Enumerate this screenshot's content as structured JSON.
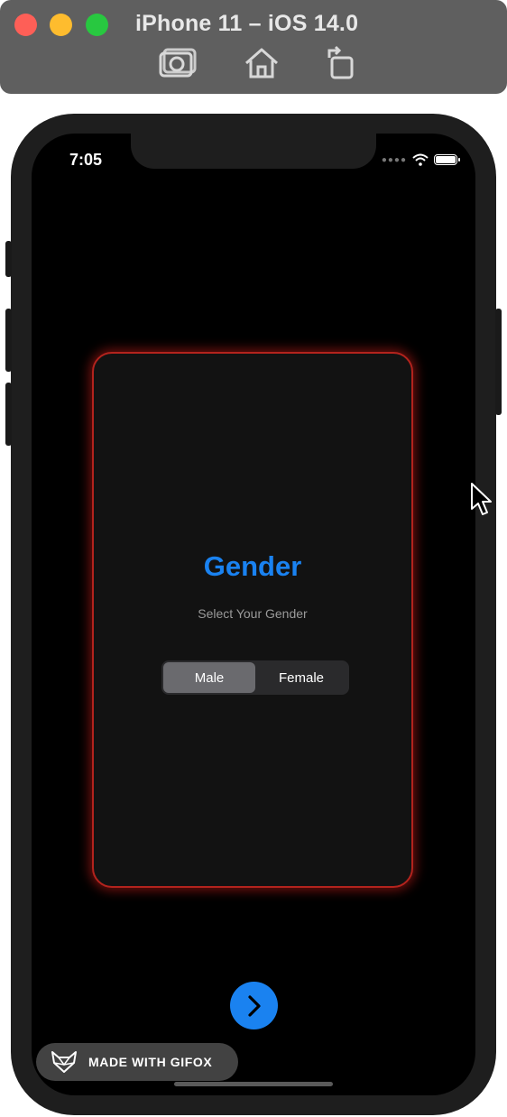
{
  "window": {
    "title": "iPhone 11 – iOS 14.0",
    "toolbar": [
      "camera-icon",
      "home-icon",
      "rotate-icon"
    ]
  },
  "status_bar": {
    "time": "7:05"
  },
  "card": {
    "title": "Gender",
    "subtitle": "Select Your Gender",
    "segment": {
      "options": [
        "Male",
        "Female"
      ],
      "selected": "Male"
    }
  },
  "watermark": {
    "text": "MADE WITH GIFOX"
  },
  "colors": {
    "accent": "#1a82f0",
    "card_border": "#b3231d",
    "background": "#000000"
  }
}
